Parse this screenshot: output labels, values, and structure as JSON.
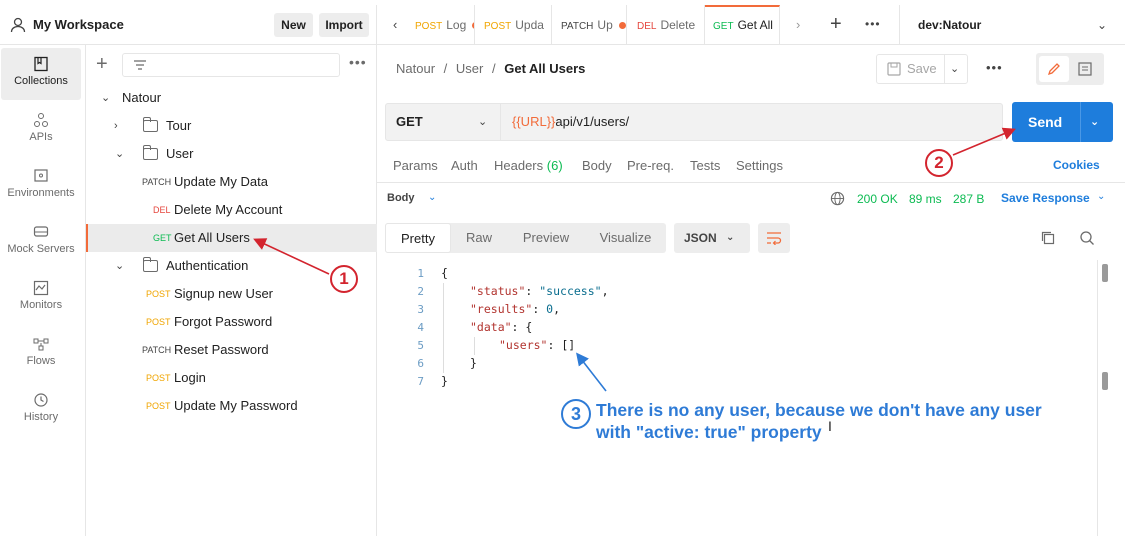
{
  "workspace": {
    "title": "My Workspace",
    "new_label": "New",
    "import_label": "Import"
  },
  "rail": [
    {
      "label": "Collections",
      "icon": "collections-icon"
    },
    {
      "label": "APIs",
      "icon": "apis-icon"
    },
    {
      "label": "Environments",
      "icon": "environments-icon"
    },
    {
      "label": "Mock Servers",
      "icon": "mock-servers-icon"
    },
    {
      "label": "Monitors",
      "icon": "monitors-icon"
    },
    {
      "label": "Flows",
      "icon": "flows-icon"
    },
    {
      "label": "History",
      "icon": "history-icon"
    }
  ],
  "tree": {
    "collection": "Natour",
    "tour": "Tour",
    "user": "User",
    "user_items": [
      {
        "method": "PATCH",
        "name": "Update My Data"
      },
      {
        "method": "DEL",
        "name": "Delete My Account"
      },
      {
        "method": "GET",
        "name": "Get All Users"
      }
    ],
    "auth": "Authentication",
    "auth_items": [
      {
        "method": "POST",
        "name": "Signup new User"
      },
      {
        "method": "POST",
        "name": "Forgot Password"
      },
      {
        "method": "PATCH",
        "name": "Reset Password"
      },
      {
        "method": "POST",
        "name": "Login"
      },
      {
        "method": "POST",
        "name": "Update My Password"
      }
    ]
  },
  "tabs": [
    {
      "method": "POST",
      "name": "Log"
    },
    {
      "method": "POST",
      "name": "Upda"
    },
    {
      "method": "PATCH",
      "name": "Up"
    },
    {
      "method": "DEL",
      "name": "Delete"
    },
    {
      "method": "GET",
      "name": "Get All"
    }
  ],
  "environment": "dev:Natour",
  "breadcrumb": {
    "c1": "Natour",
    "c2": "User",
    "current": "Get All Users",
    "sep": "/"
  },
  "save_label": "Save",
  "request": {
    "method": "GET",
    "url_var": "{{URL}}",
    "url_path": "api/v1/users/",
    "send_label": "Send"
  },
  "request_tabs": {
    "params": "Params",
    "auth": "Auth",
    "headers": "Headers",
    "headers_count": "(6)",
    "body": "Body",
    "prereq": "Pre-req.",
    "tests": "Tests",
    "settings": "Settings",
    "cookies": "Cookies"
  },
  "response": {
    "body_label": "Body",
    "status": "200 OK",
    "time": "89 ms",
    "size": "287 B",
    "save_response": "Save Response",
    "formats": [
      "Pretty",
      "Raw",
      "Preview",
      "Visualize"
    ],
    "language": "JSON"
  },
  "code_lines": [
    "1",
    "2",
    "3",
    "4",
    "5",
    "6",
    "7"
  ],
  "code": {
    "status_key": "\"status\"",
    "status_val": "\"success\"",
    "results_key": "\"results\"",
    "results_val": "0",
    "data_key": "\"data\"",
    "users_key": "\"users\"",
    "users_val": "[]"
  },
  "annotations": {
    "n1": "1",
    "n2": "2",
    "n3": "3",
    "text": "There is no any user, because we don't have any user with \"active: true\" property"
  },
  "colors": {
    "accent": "#f26b3a",
    "send": "#1e7ddc",
    "success": "#0cbb52",
    "annotation_red": "#d3242e",
    "annotation_blue": "#2e7bd6"
  }
}
